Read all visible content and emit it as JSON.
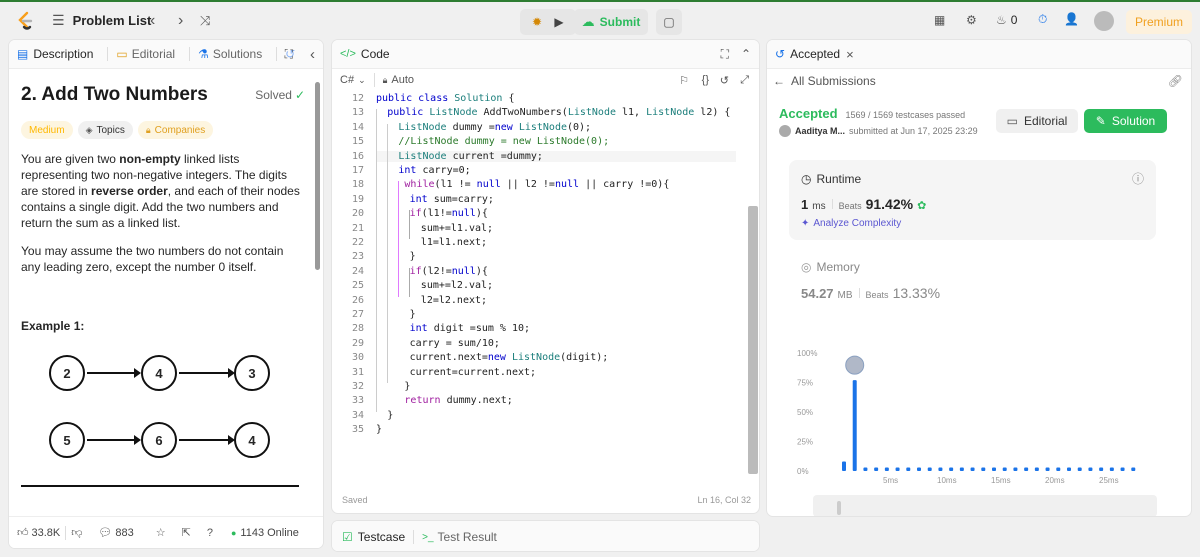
{
  "topbar": {
    "problem_list": "Problem List",
    "submit": "Submit",
    "streak": "0",
    "premium": "Premium"
  },
  "left": {
    "tabs": {
      "description": "Description",
      "editorial": "Editorial",
      "solutions": "Solutions"
    },
    "title": "2. Add Two Numbers",
    "status": "Solved",
    "tags": {
      "difficulty": "Medium",
      "topics": "Topics",
      "companies": "Companies"
    },
    "para1": [
      {
        "t": "You are given two ",
        "b": false
      },
      {
        "t": "non-empty",
        "b": true
      },
      {
        "t": " linked lists representing two non-negative integers. The digits are stored in ",
        "b": false
      },
      {
        "t": "reverse order",
        "b": true
      },
      {
        "t": ", and each of their nodes contains a single digit. Add the two numbers and return the sum as a linked list.",
        "b": false
      }
    ],
    "para2": "You may assume the two numbers do not contain any leading zero, except the number 0 itself.",
    "example_title": "Example 1:",
    "row1": [
      "2",
      "4",
      "3"
    ],
    "row2": [
      "5",
      "6",
      "4"
    ],
    "footer": {
      "likes": "33.8K",
      "comments": "883",
      "online": "1143 Online"
    }
  },
  "editor": {
    "title": "Code",
    "language": "C#",
    "mode": "Auto",
    "status": "Saved",
    "position": "Ln 16, Col 32",
    "lines": [
      {
        "n": "12",
        "i": 0,
        "s": [
          [
            "kw",
            "public class "
          ],
          [
            "ty",
            "Solution"
          ],
          [
            "",
            " {"
          ]
        ]
      },
      {
        "n": "13",
        "i": 2,
        "s": [
          [
            "kw",
            "public "
          ],
          [
            "ty",
            "ListNode "
          ],
          [
            "",
            "AddTwoNumbers("
          ],
          [
            "ty",
            "ListNode "
          ],
          [
            "",
            "l1, "
          ],
          [
            "ty",
            "ListNode "
          ],
          [
            "",
            "l2) {"
          ]
        ]
      },
      {
        "n": "14",
        "i": 4,
        "s": [
          [
            "ty",
            "ListNode "
          ],
          [
            "",
            "dummy ="
          ],
          [
            "kw",
            "new "
          ],
          [
            "ty",
            "ListNode"
          ],
          [
            "",
            "(0);"
          ]
        ]
      },
      {
        "n": "15",
        "i": 4,
        "s": [
          [
            "cm",
            "//ListNode dummy = new ListNode(0);"
          ]
        ]
      },
      {
        "n": "16",
        "i": 4,
        "s": [
          [
            "ty",
            "ListNode "
          ],
          [
            "",
            "current =dummy;"
          ]
        ]
      },
      {
        "n": "17",
        "i": 4,
        "s": [
          [
            "kw",
            "int "
          ],
          [
            "",
            "carry=0;"
          ]
        ]
      },
      {
        "n": "18",
        "i": 4,
        "s": [
          [
            "pk",
            " while"
          ],
          [
            "",
            "(l1 != "
          ],
          [
            "kw",
            "null "
          ],
          [
            "",
            "|| l2 !="
          ],
          [
            "kw",
            "null "
          ],
          [
            "",
            "|| carry !=0){"
          ]
        ]
      },
      {
        "n": "19",
        "i": 6,
        "s": [
          [
            "kw",
            "int "
          ],
          [
            "",
            "sum=carry;"
          ]
        ]
      },
      {
        "n": "20",
        "i": 6,
        "s": [
          [
            "pk",
            "if"
          ],
          [
            "",
            "(l1!="
          ],
          [
            "kw",
            "null"
          ],
          [
            "",
            "){"
          ]
        ]
      },
      {
        "n": "21",
        "i": 8,
        "s": [
          [
            "",
            "sum+=l1.val;"
          ]
        ]
      },
      {
        "n": "22",
        "i": 8,
        "s": [
          [
            "",
            "l1=l1.next;"
          ]
        ]
      },
      {
        "n": "23",
        "i": 6,
        "s": [
          [
            "",
            "}"
          ]
        ]
      },
      {
        "n": "24",
        "i": 6,
        "s": [
          [
            "pk",
            "if"
          ],
          [
            "",
            "(l2!="
          ],
          [
            "kw",
            "null"
          ],
          [
            "",
            "){"
          ]
        ]
      },
      {
        "n": "25",
        "i": 8,
        "s": [
          [
            "",
            "sum+=l2.val;"
          ]
        ]
      },
      {
        "n": "26",
        "i": 8,
        "s": [
          [
            "",
            "l2=l2.next;"
          ]
        ]
      },
      {
        "n": "27",
        "i": 6,
        "s": [
          [
            "",
            "}"
          ]
        ]
      },
      {
        "n": "28",
        "i": 6,
        "s": [
          [
            "kw",
            "int "
          ],
          [
            "",
            "digit =sum % 10;"
          ]
        ]
      },
      {
        "n": "29",
        "i": 6,
        "s": [
          [
            "",
            "carry = sum/10;"
          ]
        ]
      },
      {
        "n": "30",
        "i": 6,
        "s": [
          [
            "",
            "current.next="
          ],
          [
            "kw",
            "new "
          ],
          [
            "ty",
            "ListNode"
          ],
          [
            "",
            "(digit);"
          ]
        ]
      },
      {
        "n": "31",
        "i": 6,
        "s": [
          [
            "",
            "current=current.next;"
          ]
        ]
      },
      {
        "n": "32",
        "i": 4,
        "s": [
          [
            "",
            " }"
          ]
        ]
      },
      {
        "n": "33",
        "i": 4,
        "s": [
          [
            "pk",
            " return "
          ],
          [
            "",
            "dummy.next;"
          ]
        ]
      },
      {
        "n": "34",
        "i": 2,
        "s": [
          [
            "",
            "}"
          ]
        ]
      },
      {
        "n": "35",
        "i": 0,
        "s": [
          [
            "",
            "}"
          ]
        ]
      }
    ]
  },
  "bottom": {
    "testcase": "Testcase",
    "test_result": "Test Result"
  },
  "result": {
    "tab": "Accepted",
    "all_submissions": "All Submissions",
    "status": "Accepted",
    "testcases": "1569 / 1569 testcases passed",
    "user": "Aaditya M...",
    "submitted": "submitted at Jun 17, 2025 23:29",
    "editorial_btn": "Editorial",
    "solution_btn": "Solution",
    "runtime_label": "Runtime",
    "runtime_value": "1",
    "runtime_unit": "ms",
    "runtime_beats_label": "Beats",
    "runtime_beats": "91.42%",
    "analyze": "Analyze Complexity",
    "memory_label": "Memory",
    "memory_value": "54.27",
    "memory_unit": "MB",
    "memory_beats_label": "Beats",
    "memory_beats": "13.33%"
  },
  "chart_data": {
    "type": "bar",
    "y_ticks": [
      "100%",
      "75%",
      "50%",
      "25%",
      "0%"
    ],
    "x_ticks": [
      "5ms",
      "10ms",
      "15ms",
      "20ms",
      "25ms"
    ],
    "ylim": [
      0,
      100
    ],
    "bars": [
      8,
      77,
      3,
      3,
      3,
      3,
      3,
      3,
      3,
      3,
      3,
      3,
      3,
      3,
      3,
      3,
      3,
      3,
      3,
      3,
      3,
      3,
      3,
      3,
      3,
      3,
      3,
      3
    ],
    "highlight_index": 1
  }
}
